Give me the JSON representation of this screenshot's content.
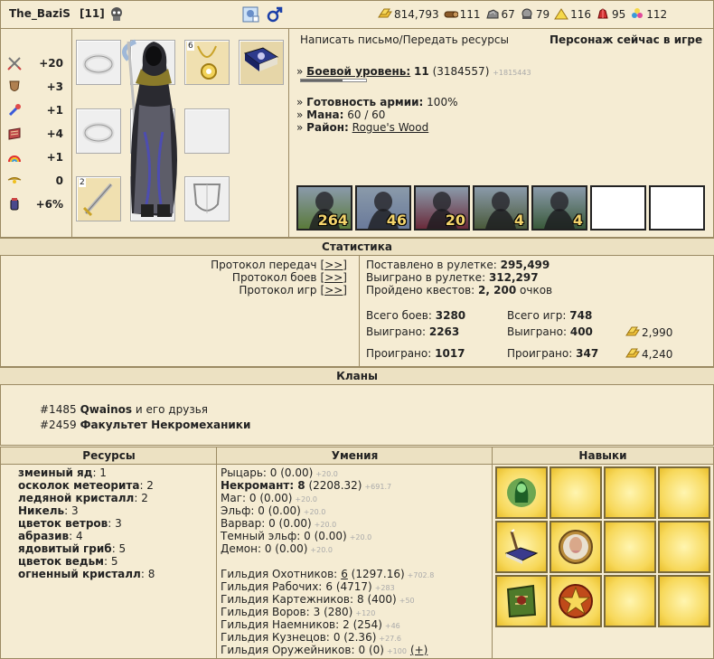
{
  "header": {
    "nickname": "The_BaziS",
    "level_badge": "[11]",
    "resources": [
      {
        "icon": "gold-icon",
        "value": "814,793"
      },
      {
        "icon": "wood-icon",
        "value": "111"
      },
      {
        "icon": "ore-icon",
        "value": "67"
      },
      {
        "icon": "mercury-icon",
        "value": "79"
      },
      {
        "icon": "sulfur-icon",
        "value": "116"
      },
      {
        "icon": "crystal-icon",
        "value": "95"
      },
      {
        "icon": "gems-icon",
        "value": "112"
      }
    ]
  },
  "stats": [
    {
      "icon": "attack-icon",
      "value": "+20"
    },
    {
      "icon": "defense-icon",
      "value": "+3"
    },
    {
      "icon": "spellpower-icon",
      "value": "+1"
    },
    {
      "icon": "knowledge-icon",
      "value": "+4"
    },
    {
      "icon": "luck-icon",
      "value": "+1"
    },
    {
      "icon": "morale-icon",
      "value": "0"
    },
    {
      "icon": "initiative-icon",
      "value": "+6%"
    }
  ],
  "equipment": {
    "amulet_count": "6",
    "weapon_count": "2"
  },
  "info": {
    "send_link": "Написать письмо/Передать ресурсы",
    "online_status": "Персонаж сейчас в игре",
    "combat_label": "Боевой уровень:",
    "combat_level": "11",
    "combat_exp": "(3184557)",
    "combat_extra": "+1815443",
    "army_label": "Готовность армии:",
    "army_value": "100%",
    "mana_label": "Мана:",
    "mana_value": "60 / 60",
    "district_label": "Район:",
    "district_value": "Rogue's Wood",
    "bullet": "»"
  },
  "army": [
    "264",
    "46",
    "20",
    "4",
    "4",
    "",
    ""
  ],
  "statistics": {
    "title": "Статистика",
    "links": [
      {
        "label": "Протокол передач",
        "btn": "[>>]"
      },
      {
        "label": "Протокол боев",
        "btn": "[>>]"
      },
      {
        "label": "Протокол игр",
        "btn": "[>>]"
      }
    ],
    "roulette_bet_label": "Поставлено в рулетке:",
    "roulette_bet": "295,499",
    "roulette_won_label": "Выиграно в рулетке:",
    "roulette_won": "312,297",
    "quests_label": "Пройдено квестов:",
    "quests": "2, 200",
    "quests_suffix": "очков",
    "battles_total_label": "Всего боев:",
    "battles_total": "3280",
    "battles_won_label": "Выиграно:",
    "battles_won": "2263",
    "battles_lost_label": "Проиграно:",
    "battles_lost": "1017",
    "games_total_label": "Всего игр:",
    "games_total": "748",
    "games_won_label": "Выиграно:",
    "games_won": "400",
    "games_lost_label": "Проиграно:",
    "games_lost": "347",
    "gold_won": "2,990",
    "gold_lost": "4,240"
  },
  "clans": {
    "title": "Кланы",
    "items": [
      {
        "id": "#1485",
        "name": "Qwainos",
        "rest": " и его друзья"
      },
      {
        "id": "#2459",
        "name": "Факультет Некромеханики",
        "rest": ""
      }
    ]
  },
  "resources_panel": {
    "title": "Ресурсы",
    "items": [
      {
        "name": "змеиный яд",
        "value": ": 1"
      },
      {
        "name": "осколок метеорита",
        "value": ": 2"
      },
      {
        "name": "ледяной кристалл",
        "value": ": 2"
      },
      {
        "name": "Никель",
        "value": ": 3"
      },
      {
        "name": "цветок ветров",
        "value": ": 3"
      },
      {
        "name": "абразив",
        "value": ": 4"
      },
      {
        "name": "ядовитый гриб",
        "value": ": 5"
      },
      {
        "name": "цветок ведьм",
        "value": ": 5"
      },
      {
        "name": "огненный кристалл",
        "value": ": 8"
      }
    ]
  },
  "skills_panel": {
    "title": "Умения",
    "factions": [
      {
        "name": "Рыцарь:",
        "value": " 0 (0.00)",
        "extra": "+20.0",
        "bold": false
      },
      {
        "name": "Некромант:",
        "value": " 8",
        "paren": " (2208.32)",
        "extra": "+691.7",
        "bold": true
      },
      {
        "name": "Маг:",
        "value": " 0 (0.00)",
        "extra": "+20.0",
        "bold": false
      },
      {
        "name": "Эльф:",
        "value": " 0 (0.00)",
        "extra": "+20.0",
        "bold": false
      },
      {
        "name": "Варвар:",
        "value": " 0 (0.00)",
        "extra": "+20.0",
        "bold": false
      },
      {
        "name": "Темный эльф:",
        "value": " 0 (0.00)",
        "extra": "+20.0",
        "bold": false
      },
      {
        "name": "Демон:",
        "value": " 0 (0.00)",
        "extra": "+20.0",
        "bold": false
      }
    ],
    "guilds": [
      {
        "name": "Гильдия Охотников:",
        "num": "6",
        "paren": " (1297.16)",
        "extra": "+702.8",
        "link": true
      },
      {
        "name": "Гильдия Рабочих:",
        "num": "6",
        "paren": " (4717)",
        "extra": "+283",
        "link": false
      },
      {
        "name": "Гильдия Картежников:",
        "num": "8",
        "paren": " (400)",
        "extra": "+50",
        "link": false
      },
      {
        "name": "Гильдия Воров:",
        "num": "3",
        "paren": " (280)",
        "extra": "+120",
        "link": false
      },
      {
        "name": "Гильдия Наемников:",
        "num": "2",
        "paren": " (254)",
        "extra": "+46",
        "link": false
      },
      {
        "name": "Гильдия Кузнецов:",
        "num": "0",
        "paren": " (2.36)",
        "extra": "+27.6",
        "link": false
      },
      {
        "name": "Гильдия Оружейников:",
        "num": "0",
        "paren": " (0)",
        "extra": "+100",
        "link": false,
        "plus": "(+)"
      }
    ]
  },
  "perks_panel": {
    "title": "Навыки"
  }
}
